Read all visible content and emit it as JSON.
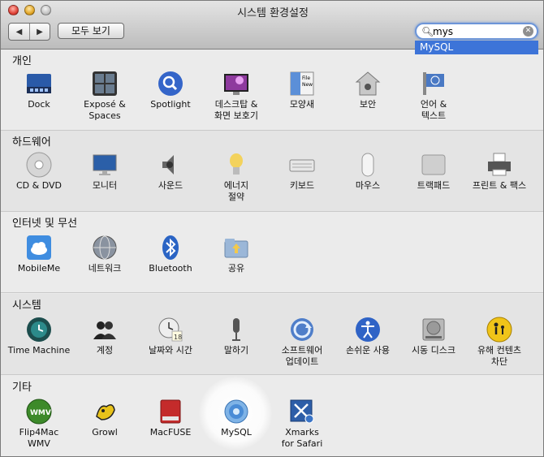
{
  "window": {
    "title": "시스템 환경설정"
  },
  "toolbar": {
    "back_label": "◀",
    "forward_label": "▶",
    "show_all_label": "모두 보기",
    "search_value": "mys",
    "search_suggestion": "MySQL"
  },
  "sections": {
    "personal": {
      "title": "개인",
      "items": [
        {
          "label": "Dock",
          "icon": "dock-icon"
        },
        {
          "label": "Exposé &\nSpaces",
          "icon": "expose-icon"
        },
        {
          "label": "Spotlight",
          "icon": "spotlight-icon"
        },
        {
          "label": "데스크탑 &\n화면 보호기",
          "icon": "desktop-icon"
        },
        {
          "label": "모양새",
          "icon": "appearance-icon"
        },
        {
          "label": "보안",
          "icon": "security-icon"
        },
        {
          "label": "언어 &\n텍스트",
          "icon": "language-icon"
        }
      ]
    },
    "hardware": {
      "title": "하드웨어",
      "items": [
        {
          "label": "CD & DVD",
          "icon": "cd-dvd-icon"
        },
        {
          "label": "모니터",
          "icon": "monitor-icon"
        },
        {
          "label": "사운드",
          "icon": "sound-icon"
        },
        {
          "label": "에너지\n절약",
          "icon": "energy-icon"
        },
        {
          "label": "키보드",
          "icon": "keyboard-icon"
        },
        {
          "label": "마우스",
          "icon": "mouse-icon"
        },
        {
          "label": "트랙패드",
          "icon": "trackpad-icon"
        },
        {
          "label": "프린트 & 팩스",
          "icon": "printer-icon"
        }
      ]
    },
    "internet": {
      "title": "인터넷 및 무선",
      "items": [
        {
          "label": "MobileMe",
          "icon": "mobileme-icon"
        },
        {
          "label": "네트워크",
          "icon": "network-icon"
        },
        {
          "label": "Bluetooth",
          "icon": "bluetooth-icon"
        },
        {
          "label": "공유",
          "icon": "sharing-icon"
        }
      ]
    },
    "system": {
      "title": "시스템",
      "items": [
        {
          "label": "Time Machine",
          "icon": "time-machine-icon"
        },
        {
          "label": "계정",
          "icon": "accounts-icon"
        },
        {
          "label": "날짜와 시간",
          "icon": "date-time-icon"
        },
        {
          "label": "말하기",
          "icon": "speech-icon"
        },
        {
          "label": "소프트웨어\n업데이트",
          "icon": "software-update-icon"
        },
        {
          "label": "손쉬운 사용",
          "icon": "accessibility-icon"
        },
        {
          "label": "시동 디스크",
          "icon": "startup-disk-icon"
        },
        {
          "label": "유해 컨텐츠\n차단",
          "icon": "parental-controls-icon"
        }
      ]
    },
    "other": {
      "title": "기타",
      "items": [
        {
          "label": "Flip4Mac\nWMV",
          "icon": "flip4mac-icon"
        },
        {
          "label": "Growl",
          "icon": "growl-icon"
        },
        {
          "label": "MacFUSE",
          "icon": "macfuse-icon"
        },
        {
          "label": "MySQL",
          "icon": "mysql-icon"
        },
        {
          "label": "Xmarks\nfor Safari",
          "icon": "xmarks-icon"
        }
      ]
    }
  },
  "icon_glyphs": {
    "time_badge": "18",
    "file_badge": "File",
    "new_badge": "New",
    "wmv_badge": "WMV"
  }
}
